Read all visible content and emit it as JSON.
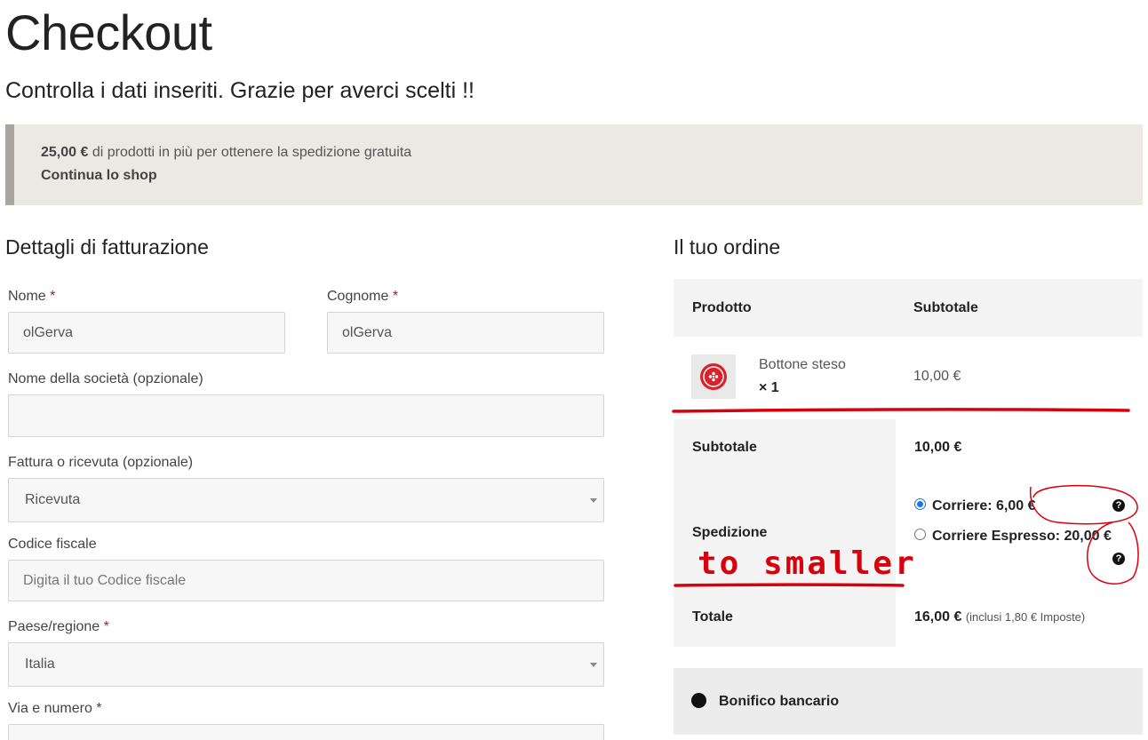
{
  "page": {
    "title": "Checkout",
    "subtitle": "Controlla i dati inseriti. Grazie per averci scelti !!"
  },
  "notice": {
    "amount": "25,00 €",
    "text": "di prodotti in più per ottenere la spedizione gratuita",
    "link": "Continua lo shop"
  },
  "billing": {
    "title": "Dettagli di fatturazione",
    "required_mark": "*",
    "first_name": {
      "label": "Nome",
      "value": "olGerva"
    },
    "last_name": {
      "label": "Cognome",
      "value": "olGerva"
    },
    "company": {
      "label": "Nome della società (opzionale)",
      "value": ""
    },
    "invoice_type": {
      "label": "Fattura o ricevuta (opzionale)",
      "value": "Ricevuta"
    },
    "tax_code": {
      "label": "Codice fiscale",
      "placeholder": "Digita il tuo Codice fiscale"
    },
    "country": {
      "label": "Paese/regione",
      "value": "Italia"
    },
    "street": {
      "label": "Via e numero"
    }
  },
  "order": {
    "title": "Il tuo ordine",
    "col_product": "Prodotto",
    "col_subtotal": "Subtotale",
    "item": {
      "name": "Bottone steso",
      "qty": "× 1",
      "price": "10,00 €"
    },
    "subtotal_label": "Subtotale",
    "subtotal_value": "10,00 €",
    "shipping_label": "Spedizione",
    "shipping_options": [
      {
        "label": "Corriere: 6,00 €",
        "selected": true
      },
      {
        "label": "Corriere Espresso: 20,00 €",
        "selected": false
      }
    ],
    "help_icon": "?",
    "total_label": "Totale",
    "total_value": "16,00 €",
    "total_note": "(inclusi 1,80 € Imposte)"
  },
  "payment": {
    "method": "Bonifico bancario"
  },
  "annotation": {
    "text": "to smaller",
    "color": "#d9000d"
  }
}
